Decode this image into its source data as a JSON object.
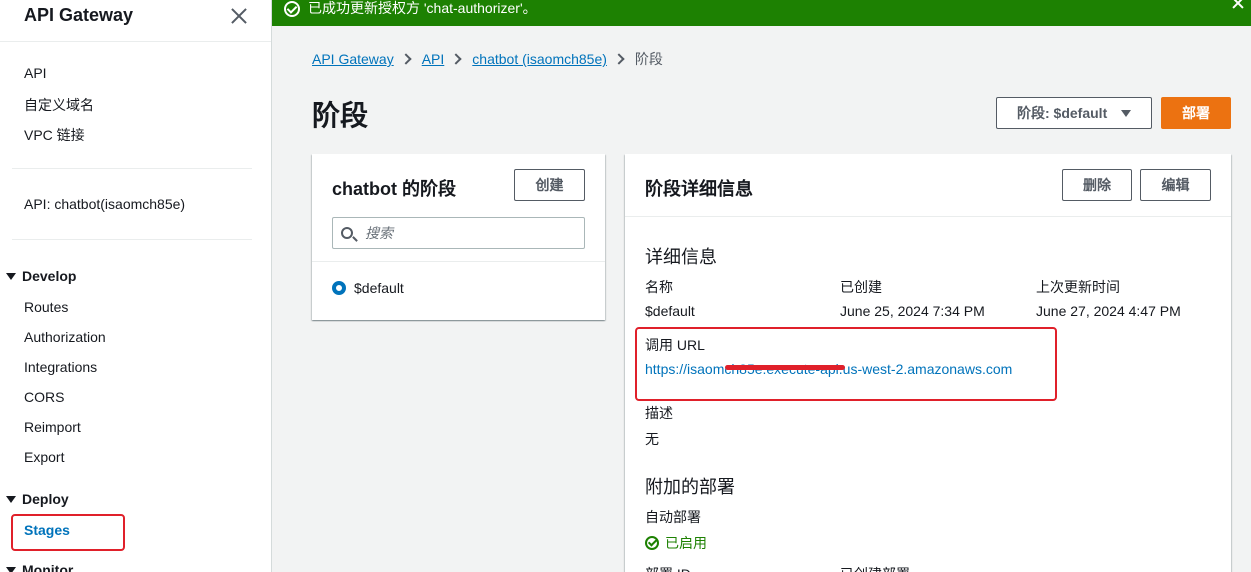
{
  "flash": {
    "message": "已成功更新授权方 'chat-authorizer'。"
  },
  "sidebar": {
    "title": "API Gateway",
    "top_links": [
      "API",
      "自定义域名",
      "VPC 链接"
    ],
    "api_label": "API: chatbot(isaomch85e)",
    "develop": {
      "label": "Develop",
      "items": [
        "Routes",
        "Authorization",
        "Integrations",
        "CORS",
        "Reimport",
        "Export"
      ]
    },
    "deploy": {
      "label": "Deploy",
      "items": [
        "Stages"
      ]
    },
    "monitor": {
      "label": "Monitor"
    }
  },
  "breadcrumb": [
    "API Gateway",
    "API",
    "chatbot (isaomch85e)",
    "阶段"
  ],
  "page_title": "阶段",
  "stage_select": "阶段: $default",
  "deploy_button": "部署",
  "stages_panel": {
    "title": "chatbot 的阶段",
    "create_button": "创建",
    "search_placeholder": "搜索",
    "stages": [
      "$default"
    ]
  },
  "details_panel": {
    "title": "阶段详细信息",
    "delete_button": "删除",
    "edit_button": "编辑",
    "section_details": "详细信息",
    "name_label": "名称",
    "name_value": "$default",
    "created_label": "已创建",
    "created_value": "June 25, 2024 7:34 PM",
    "updated_label": "上次更新时间",
    "updated_value": "June 27, 2024 4:47 PM",
    "invoke_url_label": "调用 URL",
    "invoke_url_value": "https://isaomch85e.execute-api.us-west-2.amazonaws.com",
    "description_label": "描述",
    "description_value": "无",
    "section_attached": "附加的部署",
    "auto_deploy_label": "自动部署",
    "auto_deploy_value": "已启用",
    "deployment_id_label": "部署 ID",
    "deployment_created_label": "已创建部署"
  },
  "colors": {
    "accent": "#0073bb",
    "primary_button": "#ec7211",
    "success": "#1d8102",
    "annotation": "#e0202a"
  }
}
